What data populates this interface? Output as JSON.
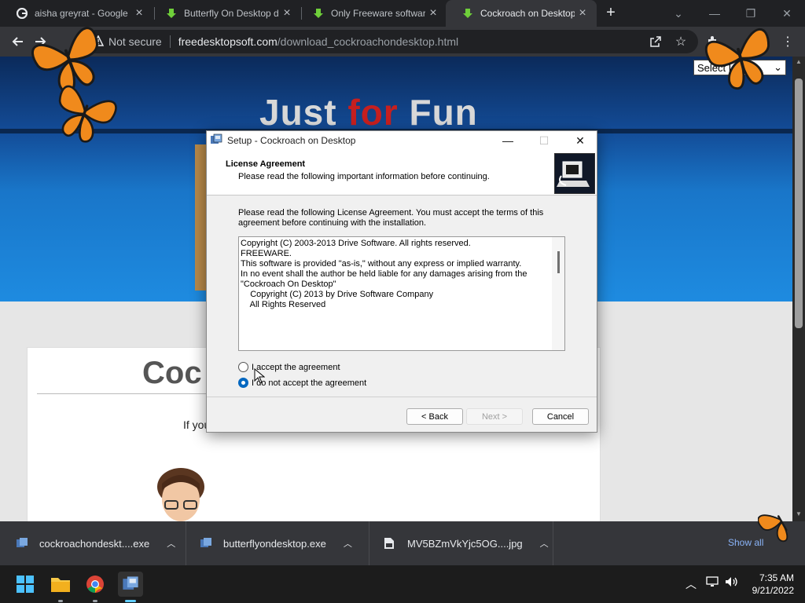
{
  "browser": {
    "tabs": [
      {
        "title": "aisha greyrat - Google",
        "icon": "google-icon",
        "active": false
      },
      {
        "title": "Butterfly On Desktop d",
        "icon": "download-arrow-icon",
        "active": false
      },
      {
        "title": "Only Freeware softwar",
        "icon": "download-arrow-icon",
        "active": false
      },
      {
        "title": "Cockroach on Desktop",
        "icon": "download-arrow-icon",
        "active": true
      }
    ],
    "security_label": "Not secure",
    "url_host": "freedesktopsoft.com",
    "url_path": "/download_cockroachondesktop.html"
  },
  "page": {
    "hero_title_1": "Just ",
    "hero_title_2": "for",
    "hero_title_3": " Fun",
    "language_select": "Select La",
    "content_title": "Coc",
    "content_text": "If you"
  },
  "dialog": {
    "title": "Setup - Cockroach on Desktop",
    "header_title": "License Agreement",
    "header_subtitle": "Please read the following important information before continuing.",
    "intro": "Please read the following License Agreement. You must accept the terms of this agreement before continuing with the installation.",
    "license_lines": [
      "Copyright (C) 2003-2013 Drive Software. All rights reserved.",
      "",
      "FREEWARE.",
      "",
      "This software is provided \"as-is,\" without any express or implied warranty.",
      "In no event shall the author be held liable for any damages arising from the",
      "\"Cockroach On Desktop\"",
      "    Copyright (C) 2013 by Drive Software Company",
      "    All Rights Reserved"
    ],
    "accept_label": "I accept the agreement",
    "decline_label": "I do not accept the agreement",
    "selected": "decline",
    "back_label": "< Back",
    "next_label": "Next >",
    "cancel_label": "Cancel"
  },
  "downloads": {
    "items": [
      {
        "name": "cockroachondeskt....exe",
        "icon": "installer-icon"
      },
      {
        "name": "butterflyondesktop.exe",
        "icon": "installer-icon"
      },
      {
        "name": "MV5BZmVkYjc5OG....jpg",
        "icon": "image-file-icon"
      }
    ],
    "show_all": "Show all"
  },
  "taskbar": {
    "time": "7:35 AM",
    "date": "9/21/2022"
  },
  "colors": {
    "accent_blue": "#0067c0",
    "hero_red": "#c61f1f",
    "link_blue": "#8ab4f8"
  }
}
